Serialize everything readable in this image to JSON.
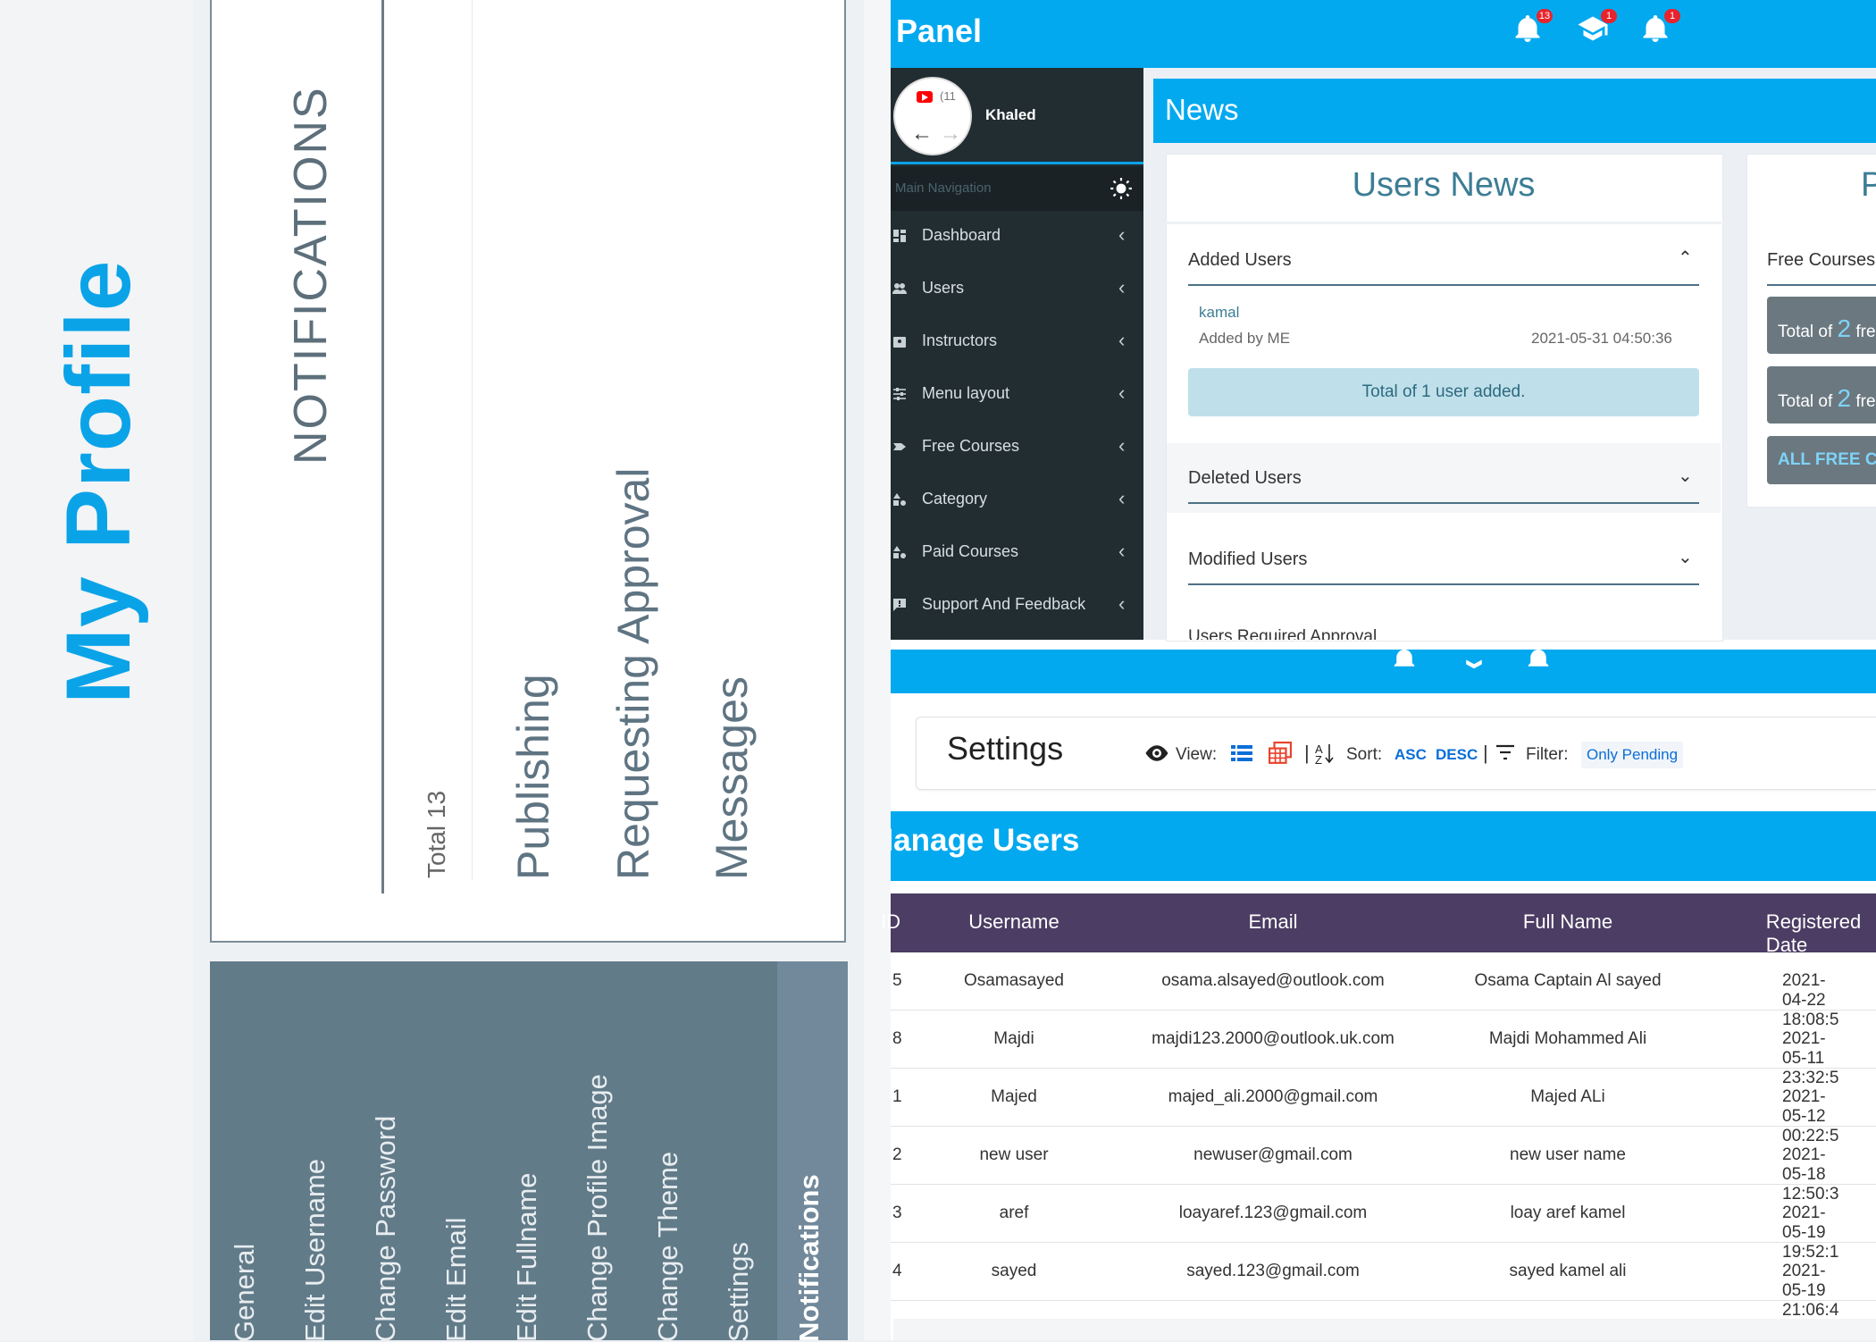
{
  "profile": {
    "title": "My Profile"
  },
  "notifications": {
    "title": "NOTIFICATIONS",
    "total": "Total 13",
    "items": [
      "Publishing",
      "Requesting Approval",
      "Messages"
    ]
  },
  "settings_sidebar": {
    "links": [
      "General",
      "Edit Username",
      "Change Password",
      "Edit Email",
      "Edit Fullname",
      "Change Profile Image",
      "Change Theme",
      "Settings",
      "Notifications"
    ]
  },
  "panel": {
    "title": "Panel",
    "badges": {
      "notifications": "13",
      "courses": "1",
      "alerts": "1"
    },
    "user": {
      "name": "Khaled",
      "tab_count": "(11"
    },
    "nav_header": "Main Navigation",
    "nav_items": [
      "Dashboard",
      "Users",
      "Instructors",
      "Menu layout",
      "Free Courses",
      "Category",
      "Paid Courses",
      "Support And Feedback"
    ],
    "news": {
      "bar_title": "News",
      "users_news_title": "Users News",
      "added_users": {
        "label": "Added Users",
        "name": "kamal",
        "by": "Added by ME",
        "date": "2021-05-31 04:50:36",
        "total": "Total of 1 user added."
      },
      "deleted_users": "Deleted Users",
      "modified_users": "Modified Users",
      "required_approval": "Users Required Approval",
      "free_box": {
        "title": "P",
        "head": "Free Courses",
        "card1_prefix": "Total of",
        "card1_num": "2",
        "card1_suffix": "fre",
        "card2_prefix": "Total of",
        "card2_num": "2",
        "card2_suffix": "fre",
        "all": "ALL FREE CO"
      }
    }
  },
  "settings_toolbar": {
    "title": "Settings",
    "view_label": "View:",
    "sort_label": "Sort:",
    "sort_asc": "ASC",
    "sort_desc": "DESC",
    "filter_label": "Filter:",
    "filter_value": "Only Pending",
    "separators": [
      "|",
      "|"
    ]
  },
  "manage_users": {
    "title": "Manage Users",
    "columns": [
      "ID",
      "Username",
      "Email",
      "Full Name",
      "Registered Date"
    ],
    "rows": [
      {
        "id": "5",
        "username": "Osamasayed",
        "email": "osama.alsayed@outlook.com",
        "full_name": "Osama Captain Al sayed",
        "date": "2021-04-22 18:08:5"
      },
      {
        "id": "8",
        "username": "Majdi",
        "email": "majdi123.2000@outlook.uk.com",
        "full_name": "Majdi Mohammed Ali",
        "date": "2021-05-11 23:32:5"
      },
      {
        "id": "1",
        "username": "Majed",
        "email": "majed_ali.2000@gmail.com",
        "full_name": "Majed ALi",
        "date": "2021-05-12 00:22:5"
      },
      {
        "id": "2",
        "username": "new user",
        "email": "newuser@gmail.com",
        "full_name": "new user name",
        "date": "2021-05-18 12:50:3"
      },
      {
        "id": "3",
        "username": "aref",
        "email": "loayaref.123@gmail.com",
        "full_name": "loay aref kamel",
        "date": "2021-05-19 19:52:1"
      },
      {
        "id": "4",
        "username": "sayed",
        "email": "sayed.123@gmail.com",
        "full_name": "sayed kamel ali",
        "date": "2021-05-19 21:06:4"
      }
    ]
  },
  "colors": {
    "accent": "#03a9ef",
    "nav_dark": "#222d32",
    "table_header": "#4b3d63",
    "sidebar": "#627b89"
  }
}
